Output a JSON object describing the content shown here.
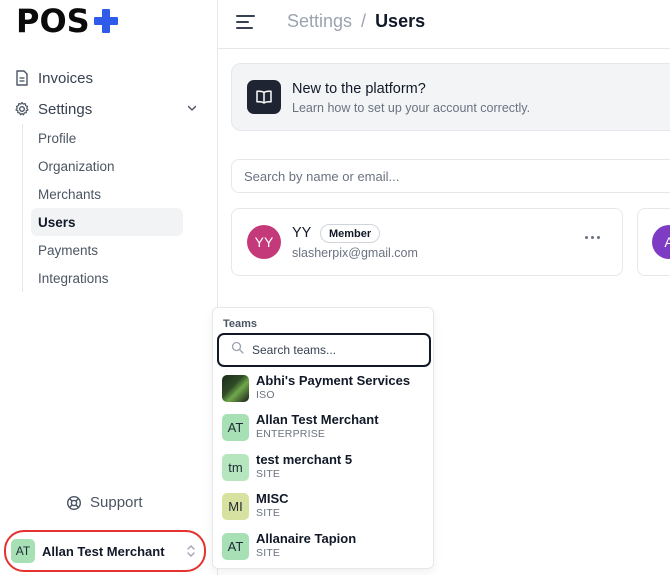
{
  "logo": {
    "text": "POS"
  },
  "sidebar": {
    "nav": [
      {
        "label": "Invoices"
      },
      {
        "label": "Settings"
      }
    ],
    "settings_items": [
      {
        "label": "Profile"
      },
      {
        "label": "Organization"
      },
      {
        "label": "Merchants"
      },
      {
        "label": "Users",
        "active": true
      },
      {
        "label": "Payments"
      },
      {
        "label": "Integrations"
      }
    ],
    "support_label": "Support",
    "account": {
      "initials": "AT",
      "name": "Allan Test Merchant"
    }
  },
  "header": {
    "breadcrumb_parent": "Settings",
    "breadcrumb_sep": "/",
    "breadcrumb_current": "Users"
  },
  "banner": {
    "title": "New to the platform?",
    "subtitle": "Learn how to set up your account correctly."
  },
  "user_search": {
    "placeholder": "Search by name or email..."
  },
  "users": [
    {
      "initials": "YY",
      "name": "YY",
      "role": "Member",
      "email": "slasherpix@gmail.com",
      "color": "#c4397a"
    },
    {
      "initials": "A",
      "color": "#7e3bc4"
    }
  ],
  "teams": {
    "label": "Teams",
    "search_placeholder": "Search teams...",
    "items": [
      {
        "initials": "",
        "name": "Abhi's Payment Services",
        "type": "ISO",
        "color": "#2f4a25"
      },
      {
        "initials": "AT",
        "name": "Allan Test Merchant",
        "type": "ENTERPRISE",
        "color": "#a7e0b5"
      },
      {
        "initials": "tm",
        "name": "test merchant 5",
        "type": "SITE",
        "color": "#b6e6bd"
      },
      {
        "initials": "MI",
        "name": "MISC",
        "type": "SITE",
        "color": "#d8e2a0"
      },
      {
        "initials": "AT",
        "name": "Allanaire Tapion",
        "type": "SITE",
        "color": "#a7e0b5"
      }
    ]
  },
  "colors": {
    "accent": "#2f5bea",
    "highlight": "#e5322e"
  }
}
